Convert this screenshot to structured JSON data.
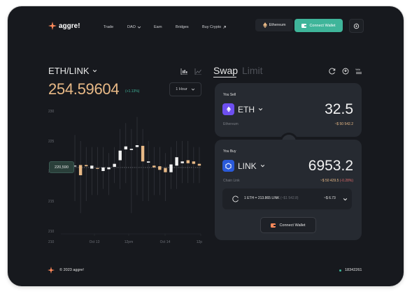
{
  "brand": {
    "name": "aggre!",
    "accent": "#3fb59a",
    "gold": "#e8b986",
    "orange": "#ff8a5b"
  },
  "nav": [
    {
      "label": "Trade"
    },
    {
      "label": "DAO",
      "icon": "chevron-down-icon"
    },
    {
      "label": "Earn"
    },
    {
      "label": "Bridges"
    },
    {
      "label": "Buy Crypto",
      "icon": "external-arrow-icon"
    }
  ],
  "header": {
    "network": "Ethereum",
    "connect": "Connect Wallet"
  },
  "market": {
    "pair": "ETH/LINK",
    "price": "254.59604",
    "change": "(+1.13%)",
    "timeframe": "1 Hour",
    "current_tag": "220,590"
  },
  "chart_data": {
    "type": "candlestick",
    "y_ticks": [
      "230",
      "225",
      "220",
      "215",
      "210"
    ],
    "ylim": [
      210,
      230
    ],
    "x_ticks": [
      "Oct 13",
      "12pm",
      "Oct 14",
      "12pm"
    ],
    "current": 220.59,
    "candles": [
      {
        "o": 220.9,
        "c": 220.9,
        "h": 226,
        "l": 215
      },
      {
        "o": 221.0,
        "c": 219.3,
        "h": 225,
        "l": 213
      },
      {
        "o": 221.0,
        "c": 220.8,
        "h": 224,
        "l": 215
      },
      {
        "o": 220.4,
        "c": 220.9,
        "h": 224,
        "l": 216
      },
      {
        "o": 220.5,
        "c": 220.4,
        "h": 224,
        "l": 216
      },
      {
        "o": 220.0,
        "c": 220.6,
        "h": 224,
        "l": 217
      },
      {
        "o": 220.3,
        "c": 220.6,
        "h": 223,
        "l": 216
      },
      {
        "o": 220.7,
        "c": 221.2,
        "h": 224,
        "l": 218
      },
      {
        "o": 221.8,
        "c": 223.4,
        "h": 227,
        "l": 217
      },
      {
        "o": 223.6,
        "c": 224.1,
        "h": 228,
        "l": 218
      },
      {
        "o": 223.5,
        "c": 223.7,
        "h": 227,
        "l": 213
      },
      {
        "o": 224.0,
        "c": 224.3,
        "h": 229,
        "l": 216
      },
      {
        "o": 224.2,
        "c": 221.6,
        "h": 227,
        "l": 215
      },
      {
        "o": 221.4,
        "c": 221.6,
        "h": 225,
        "l": 215
      },
      {
        "o": 220.9,
        "c": 220.6,
        "h": 224,
        "l": 216
      },
      {
        "o": 220.8,
        "c": 220.2,
        "h": 224,
        "l": 216
      },
      {
        "o": 220.5,
        "c": 219.8,
        "h": 223,
        "l": 215
      },
      {
        "o": 219.8,
        "c": 221.1,
        "h": 224,
        "l": 217
      },
      {
        "o": 220.9,
        "c": 222.3,
        "h": 225,
        "l": 217
      },
      {
        "o": 221.3,
        "c": 221.6,
        "h": 225,
        "l": 218
      },
      {
        "o": 221.8,
        "c": 221.3,
        "h": 225,
        "l": 218
      },
      {
        "o": 221.6,
        "c": 221.2,
        "h": 224,
        "l": 218
      },
      {
        "o": 221.2,
        "c": 220.9,
        "h": 224,
        "l": 218
      }
    ]
  },
  "swap": {
    "tab_active": "Swap",
    "tab_inactive": "Limit",
    "sell": {
      "label": "You Sell",
      "token": "ETH",
      "amount": "32.5",
      "chain": "Ethereum",
      "usd": "~$ 50 542.2"
    },
    "buy": {
      "label": "You Buy",
      "token": "LINK",
      "amount": "6953.2",
      "chain": "Chain Link",
      "usd": "~$ 50 429.5",
      "diff": "(-0.28%)"
    },
    "rate": "1 ETH = 213.865 LINK",
    "rate_usd": "(~$1 542.8)",
    "gas": "~$ 6.73",
    "connect": "Connect Wallet"
  },
  "footer": {
    "copyright": "© 2023 aggre!",
    "block": "18342261"
  }
}
